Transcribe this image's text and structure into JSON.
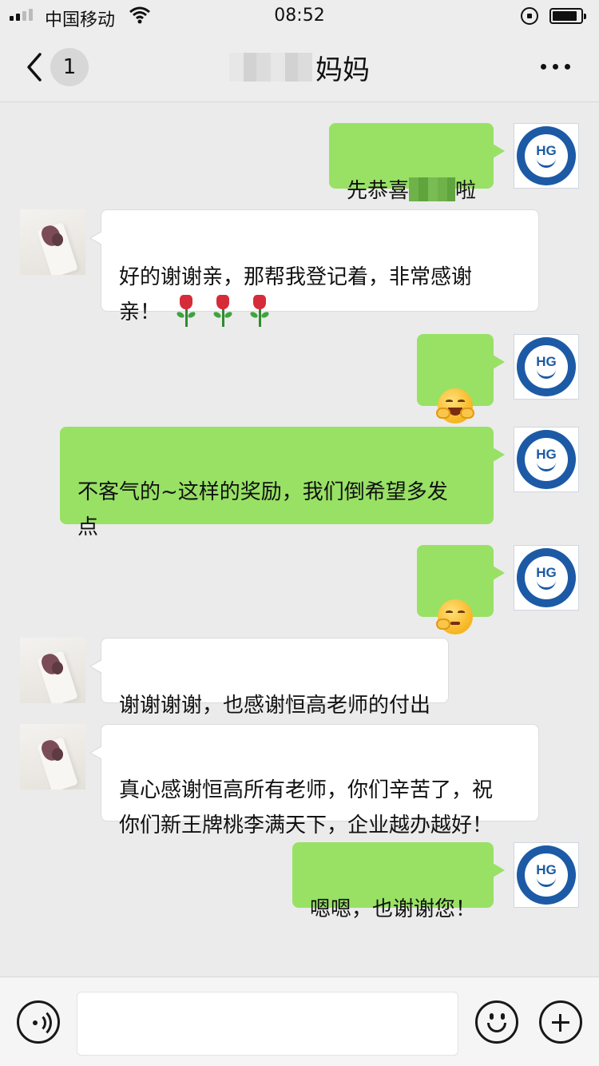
{
  "status_bar": {
    "carrier": "中国移动",
    "time": "08:52"
  },
  "nav": {
    "unread_count": "1",
    "contact_name": "妈妈"
  },
  "messages": [
    {
      "side": "out",
      "pre": "先恭喜",
      "post": "啦"
    },
    {
      "side": "in",
      "text": "好的谢谢亲，那帮我登记着，非常感谢\n亲！",
      "roses": 3
    },
    {
      "side": "out",
      "emoji": "hugging-face"
    },
    {
      "side": "out",
      "text": "不客气的~这样的奖励，我们倒希望多发\n点"
    },
    {
      "side": "out",
      "emoji": "thinking-face"
    },
    {
      "side": "in",
      "text": "谢谢谢谢，也感谢恒高老师的付出"
    },
    {
      "side": "in",
      "text": "真心感谢恒高所有老师，你们辛苦了，祝\n你们新王牌桃李满天下，企业越办越好！"
    },
    {
      "side": "out",
      "text": "嗯嗯，也谢谢您！"
    }
  ],
  "avatar_logo_text": "HG",
  "colors": {
    "sent_bubble": "#98e165",
    "received_bubble": "#ffffff",
    "background": "#ebebeb",
    "logo_blue": "#1c5aa6"
  },
  "input": {
    "placeholder": "",
    "value": ""
  },
  "icons": [
    "back-chevron-icon",
    "more-icon",
    "voice-icon",
    "emoji-icon",
    "plus-icon"
  ]
}
